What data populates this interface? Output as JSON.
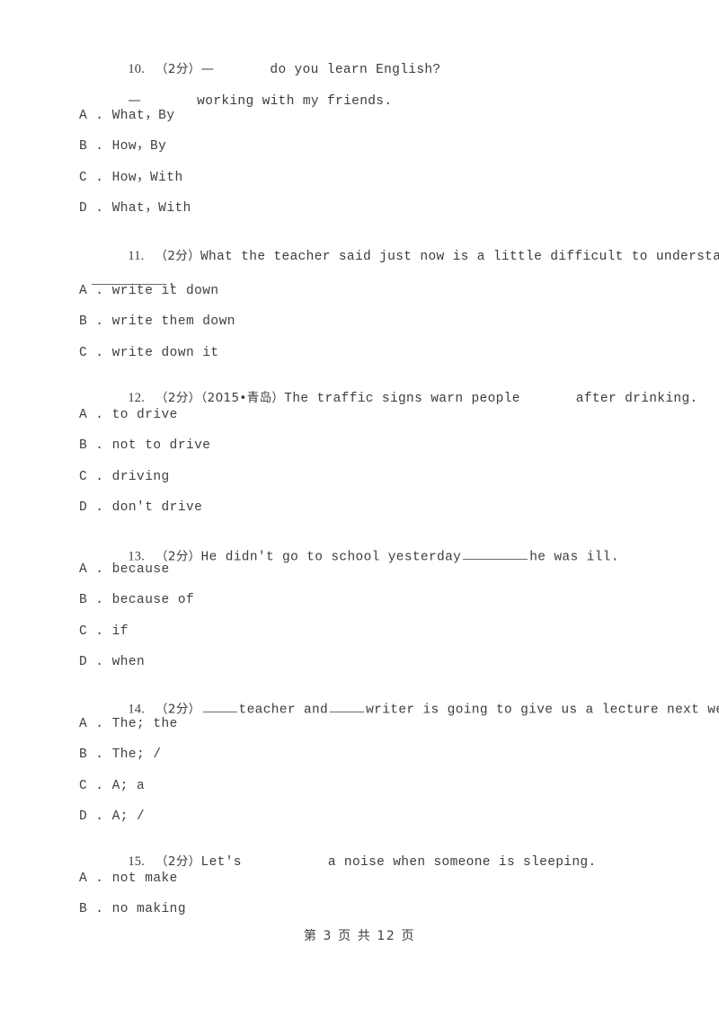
{
  "document": {
    "type": "exam-worksheet-page",
    "language": "zh-CN/en",
    "page_background": "#ffffff",
    "text_color": "#3c3c3c"
  },
  "questions": [
    {
      "number": "10.",
      "marks": "（2分）",
      "stem_line1_prefix": "—",
      "stem_line1_rest": "do you learn English?",
      "stem_line2_prefix": "—",
      "stem_line2_rest": "working with my friends.",
      "options": [
        "A . What，By",
        "B . How，By",
        "C . How，With",
        "D . What，With"
      ]
    },
    {
      "number": "11.",
      "marks": "（2分）",
      "stem_line1": "What the teacher said just now is a little difficult to understand. You'd better",
      "stem_line2_suffix": ".",
      "options": [
        "A . write it down",
        "B . write them down",
        "C . write down it"
      ]
    },
    {
      "number": "12.",
      "marks": "（2分）",
      "source": "（2015•青岛）",
      "stem_before": "The traffic signs warn people",
      "stem_after": "after drinking.",
      "options": [
        "A . to drive",
        "B . not to drive",
        "C . driving",
        "D . don't drive"
      ]
    },
    {
      "number": "13.",
      "marks": "（2分）",
      "stem_before": "He didn't go to school yesterday",
      "stem_after": "he was ill.",
      "options": [
        "A . because",
        "B . because of",
        "C . if",
        "D . when"
      ]
    },
    {
      "number": "14.",
      "marks": "（2分）",
      "stem_part1": "",
      "stem_part2": "teacher and",
      "stem_part3": "writer is going to give us a lecture next week.",
      "options": [
        "A . The; the",
        "B . The; /",
        "C . A; a",
        "D . A; /"
      ]
    },
    {
      "number": "15.",
      "marks": "（2分）",
      "stem_before": "Let's",
      "stem_after": "a noise when someone is sleeping.",
      "options": [
        "A . not make",
        "B . no making"
      ]
    }
  ],
  "footer": {
    "text": "第 3 页 共 12 页",
    "current_page": "3",
    "total_pages": "12"
  }
}
